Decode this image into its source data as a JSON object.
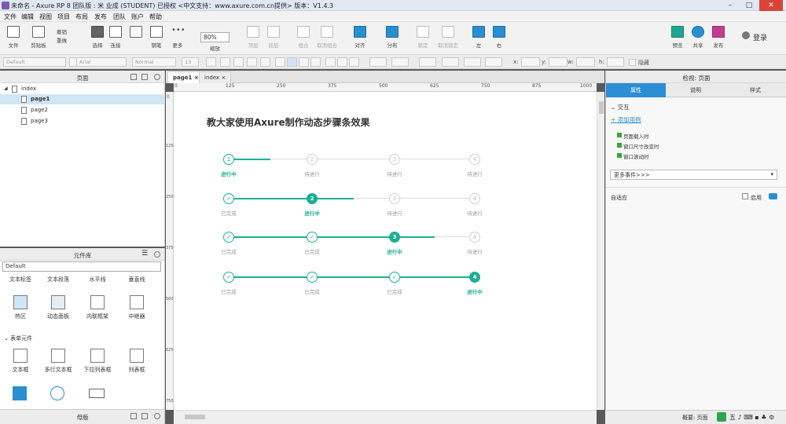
{
  "title_bar": {
    "title": "未命名 - Axure RP 8 团队版 : 米 业成 (STUDENT) 已授权    <中文支持：www.axure.com.cn提供> 版本：V1.4.3"
  },
  "menu": [
    "文件",
    "编辑",
    "视图",
    "项目",
    "布局",
    "发布",
    "团队",
    "账户",
    "帮助"
  ],
  "toolbar": {
    "file": "文件",
    "clipboard": "剪贴板",
    "undo": "撤销",
    "redo": "重做",
    "select": "选择",
    "connect": "连接",
    "pen": "钢笔",
    "more": "更多",
    "zoom_value": "80%",
    "zoom_label": "缩放",
    "top": "顶层",
    "bottom": "底层",
    "group": "组合",
    "ungroup": "取消组合",
    "align": "对齐",
    "distribute": "分布",
    "lock": "锁定",
    "unlock": "取消锁定",
    "left": "左",
    "right": "右",
    "preview": "预览",
    "share": "共享",
    "publish": "发布",
    "login": "登录"
  },
  "format_bar": {
    "style": "Default",
    "font": "Arial",
    "weight": "Normal",
    "size": "13",
    "x_label": "x:",
    "y_label": "y:",
    "w_label": "w:",
    "h_label": "h:",
    "hidden_label": "隐藏"
  },
  "pages_panel": {
    "title": "页面",
    "items": [
      {
        "label": "index"
      },
      {
        "label": "page1"
      },
      {
        "label": "page2"
      },
      {
        "label": "page3"
      }
    ]
  },
  "widgets_panel": {
    "title": "元件库",
    "library": "Default",
    "row_labels": [
      "文本标签",
      "文本段落",
      "水平线",
      "垂直线"
    ],
    "widgets": [
      "热区",
      "动态面板",
      "内联框架",
      "中继器"
    ],
    "form_section": "表单元件",
    "form_widgets": [
      "文本框",
      "多行文本框",
      "下拉列表框",
      "列表框"
    ]
  },
  "masters_panel": {
    "title": "母版"
  },
  "tabs": [
    {
      "label": "page1"
    },
    {
      "label": "index"
    }
  ],
  "ruler": {
    "h_ticks": [
      "0",
      "125",
      "250",
      "375",
      "500",
      "625",
      "750",
      "875",
      "1000"
    ],
    "v_ticks": [
      "0",
      "125",
      "250",
      "375",
      "500",
      "625",
      "750"
    ]
  },
  "canvas": {
    "title": "教大家使用Axure制作动态步骤条效果"
  },
  "steps": {
    "rows": [
      {
        "current": 1,
        "nums": [
          "1",
          "2",
          "3",
          "4"
        ],
        "labels": [
          "进行中",
          "待进行",
          "待进行",
          "待进行"
        ]
      },
      {
        "current": 2,
        "nums": [
          "✓",
          "2",
          "3",
          "4"
        ],
        "labels": [
          "已完成",
          "进行中",
          "待进行",
          "待进行"
        ]
      },
      {
        "current": 3,
        "nums": [
          "✓",
          "✓",
          "3",
          "4"
        ],
        "labels": [
          "已完成",
          "已完成",
          "进行中",
          "待进行"
        ]
      },
      {
        "current": 4,
        "nums": [
          "✓",
          "✓",
          "✓",
          "4"
        ],
        "labels": [
          "已完成",
          "已完成",
          "已完成",
          "进行中"
        ]
      }
    ],
    "accent": "#1dae94"
  },
  "inspector": {
    "header": "检视: 页面",
    "tabs": [
      "属性",
      "说明",
      "样式"
    ],
    "section": "交互",
    "add_case": "添加用例",
    "events": [
      "页面载入时",
      "窗口尺寸改变时",
      "窗口滚动时"
    ],
    "more_events": "更多事件>>>",
    "adaptive": "自适应",
    "enable": "启用"
  },
  "status": {
    "overview": "概要: 页面"
  }
}
